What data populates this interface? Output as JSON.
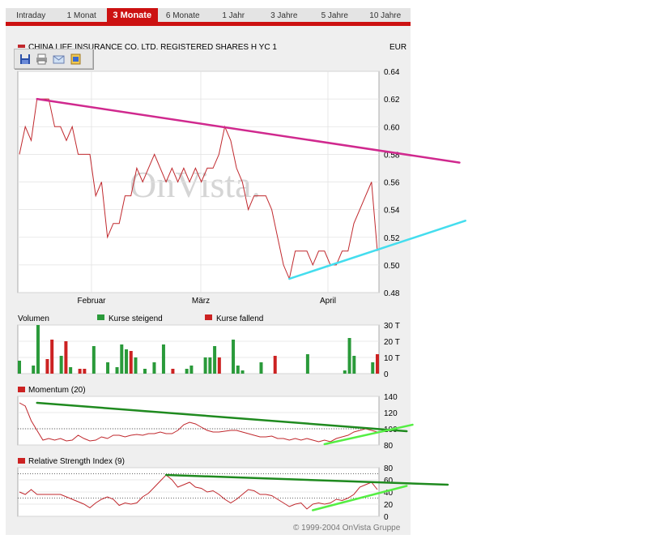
{
  "tabs": [
    {
      "label": "Intraday",
      "active": false
    },
    {
      "label": "1 Monat",
      "active": false
    },
    {
      "label": "3 Monate",
      "active": true
    },
    {
      "label": "6 Monate",
      "active": false
    },
    {
      "label": "1 Jahr",
      "active": false
    },
    {
      "label": "3 Jahre",
      "active": false
    },
    {
      "label": "5 Jahre",
      "active": false
    },
    {
      "label": "10 Jahre",
      "active": false
    }
  ],
  "header": {
    "title": "CHINA LIFE INSURANCE CO. LTD. REGISTERED SHARES H YC 1",
    "currency": "EUR"
  },
  "toolbar": {
    "icons": [
      "save-icon",
      "print-icon",
      "email-icon",
      "export-icon"
    ]
  },
  "watermark": "OnVista.",
  "volume_legend": {
    "title": "Volumen",
    "up": "Kurse steigend",
    "down": "Kurse fallend"
  },
  "momentum_legend": {
    "title": "Momentum (20)"
  },
  "rsi_legend": {
    "title": "Relative Strength Index (9)"
  },
  "copyright": "© 1999-2004 OnVista Gruppe",
  "colors": {
    "price": "#c0282d",
    "resistance": "#d0298e",
    "support": "#44ddee",
    "up": "#2a9a3a",
    "down": "#cc2222",
    "trend_dark": "#1f8a1f",
    "trend_light": "#55ee44"
  },
  "chart_data": [
    {
      "type": "line",
      "name": "price",
      "x_ticks": [
        "Februar",
        "März",
        "April"
      ],
      "y_ticks": [
        "0.64",
        "0.62",
        "0.60",
        "0.58",
        "0.56",
        "0.54",
        "0.52",
        "0.50",
        "0.48"
      ],
      "ylim": [
        0.48,
        0.64
      ],
      "values": [
        0.58,
        0.6,
        0.59,
        0.62,
        0.62,
        0.62,
        0.6,
        0.6,
        0.59,
        0.6,
        0.58,
        0.58,
        0.58,
        0.55,
        0.56,
        0.52,
        0.53,
        0.53,
        0.55,
        0.55,
        0.57,
        0.56,
        0.57,
        0.58,
        0.57,
        0.56,
        0.57,
        0.56,
        0.57,
        0.56,
        0.57,
        0.56,
        0.57,
        0.57,
        0.58,
        0.6,
        0.59,
        0.57,
        0.56,
        0.54,
        0.55,
        0.55,
        0.55,
        0.54,
        0.52,
        0.5,
        0.49,
        0.51,
        0.51,
        0.51,
        0.5,
        0.51,
        0.51,
        0.5,
        0.5,
        0.51,
        0.51,
        0.53,
        0.54,
        0.55,
        0.56,
        0.51
      ],
      "trendlines": [
        {
          "kind": "resistance",
          "from": [
            3,
            0.62
          ],
          "to": [
            75,
            0.574
          ]
        },
        {
          "kind": "support",
          "from": [
            46,
            0.49
          ],
          "to": [
            76,
            0.532
          ]
        }
      ]
    },
    {
      "type": "bar",
      "name": "volume",
      "y_ticks": [
        "30 T",
        "20 T",
        "10 T",
        "0"
      ],
      "ylim": [
        0,
        30
      ],
      "values": [
        8,
        0,
        0,
        5,
        30,
        0,
        9,
        21,
        0,
        11,
        20,
        4,
        0,
        3,
        3,
        0,
        17,
        0,
        0,
        7,
        0,
        4,
        18,
        15,
        14,
        10,
        0,
        3,
        0,
        7,
        0,
        18,
        0,
        3,
        0,
        0,
        3,
        5,
        0,
        0,
        10,
        10,
        17,
        10,
        0,
        0,
        21,
        5,
        2,
        0,
        0,
        0,
        7,
        0,
        0,
        11,
        0,
        0,
        0,
        0,
        0,
        0,
        12,
        0,
        0,
        0,
        0,
        0,
        0,
        0,
        2,
        22,
        11,
        0,
        0,
        0,
        7,
        12
      ],
      "direction": [
        "u",
        "u",
        "u",
        "u",
        "u",
        "u",
        "d",
        "d",
        "u",
        "u",
        "d",
        "u",
        "u",
        "d",
        "d",
        "u",
        "u",
        "u",
        "u",
        "u",
        "u",
        "u",
        "u",
        "u",
        "d",
        "u",
        "u",
        "u",
        "u",
        "u",
        "u",
        "u",
        "u",
        "d",
        "u",
        "u",
        "u",
        "u",
        "u",
        "u",
        "u",
        "u",
        "u",
        "d",
        "u",
        "d",
        "u",
        "u",
        "u",
        "u",
        "u",
        "u",
        "u",
        "u",
        "u",
        "d",
        "u",
        "u",
        "u",
        "u",
        "u",
        "u",
        "u",
        "u",
        "u",
        "u",
        "u",
        "u",
        "u",
        "u",
        "u",
        "u",
        "u",
        "u",
        "u",
        "u",
        "u",
        "d"
      ]
    },
    {
      "type": "line",
      "name": "momentum",
      "y_ticks": [
        "140",
        "120",
        "100",
        "80"
      ],
      "ylim": [
        80,
        140
      ],
      "reference": 100,
      "values": [
        132,
        128,
        110,
        98,
        86,
        88,
        86,
        88,
        85,
        86,
        92,
        88,
        85,
        86,
        90,
        88,
        92,
        92,
        90,
        92,
        93,
        92,
        94,
        94,
        96,
        94,
        94,
        98,
        105,
        108,
        106,
        102,
        98,
        96,
        96,
        97,
        98,
        98,
        96,
        94,
        92,
        90,
        90,
        91,
        88,
        88,
        86,
        88,
        86,
        88,
        86,
        84,
        86,
        84,
        88,
        90,
        92,
        96,
        98,
        100,
        98,
        96
      ],
      "trendlines": [
        {
          "kind": "dark",
          "from": [
            3,
            132
          ],
          "to": [
            66,
            97
          ]
        },
        {
          "kind": "light",
          "from": [
            52,
            81
          ],
          "to": [
            67,
            105
          ]
        }
      ]
    },
    {
      "type": "line",
      "name": "rsi",
      "y_ticks": [
        "80",
        "60",
        "40",
        "20",
        "0"
      ],
      "ylim": [
        0,
        80
      ],
      "reference_lines": [
        30,
        70
      ],
      "values": [
        40,
        36,
        44,
        36,
        36,
        36,
        36,
        36,
        32,
        28,
        24,
        20,
        14,
        22,
        28,
        32,
        28,
        18,
        22,
        20,
        22,
        32,
        38,
        48,
        58,
        68,
        60,
        48,
        52,
        56,
        48,
        46,
        40,
        42,
        36,
        28,
        22,
        28,
        36,
        44,
        42,
        36,
        36,
        34,
        28,
        22,
        16,
        20,
        22,
        12,
        20,
        22,
        20,
        22,
        28,
        26,
        30,
        36,
        48,
        52,
        56,
        44
      ],
      "trendlines": [
        {
          "kind": "dark",
          "from": [
            25,
            68
          ],
          "to": [
            73,
            52
          ]
        },
        {
          "kind": "light",
          "from": [
            50,
            10
          ],
          "to": [
            66,
            50
          ]
        }
      ]
    }
  ]
}
